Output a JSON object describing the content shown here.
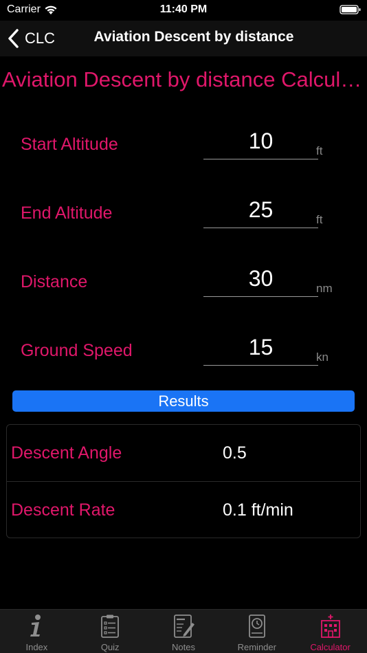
{
  "status_bar": {
    "carrier": "Carrier",
    "time": "11:40 PM"
  },
  "nav": {
    "back_label": "CLC",
    "title": "Aviation Descent by distance"
  },
  "heading": "Aviation Descent by distance Calculator",
  "inputs": [
    {
      "label": "Start Altitude",
      "value": "10",
      "unit": "ft"
    },
    {
      "label": "End Altitude",
      "value": "25",
      "unit": "ft"
    },
    {
      "label": "Distance",
      "value": "30",
      "unit": "nm"
    },
    {
      "label": "Ground Speed",
      "value": "15",
      "unit": "kn"
    }
  ],
  "results_button_label": "Results",
  "results": [
    {
      "label": "Descent Angle",
      "value": "0.5"
    },
    {
      "label": "Descent Rate",
      "value": "0.1 ft/min"
    }
  ],
  "tabs": [
    {
      "label": "Index",
      "icon": "info-icon",
      "active": false
    },
    {
      "label": "Quiz",
      "icon": "clipboard-list-icon",
      "active": false
    },
    {
      "label": "Notes",
      "icon": "notes-pen-icon",
      "active": false
    },
    {
      "label": "Reminder",
      "icon": "clock-icon",
      "active": false
    },
    {
      "label": "Calculator",
      "icon": "building-icon",
      "active": true
    }
  ],
  "colors": {
    "accent": "#e0176a",
    "button": "#1a74f5",
    "background": "#000000"
  }
}
